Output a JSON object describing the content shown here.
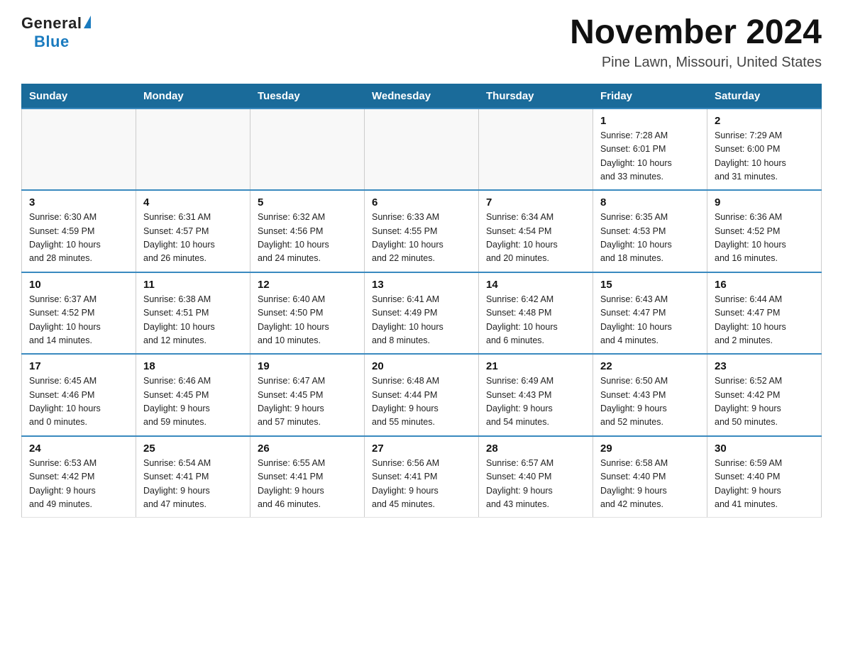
{
  "header": {
    "logo_general": "General",
    "logo_blue": "Blue",
    "month_title": "November 2024",
    "location": "Pine Lawn, Missouri, United States"
  },
  "weekdays": [
    "Sunday",
    "Monday",
    "Tuesday",
    "Wednesday",
    "Thursday",
    "Friday",
    "Saturday"
  ],
  "weeks": [
    [
      {
        "day": "",
        "info": ""
      },
      {
        "day": "",
        "info": ""
      },
      {
        "day": "",
        "info": ""
      },
      {
        "day": "",
        "info": ""
      },
      {
        "day": "",
        "info": ""
      },
      {
        "day": "1",
        "info": "Sunrise: 7:28 AM\nSunset: 6:01 PM\nDaylight: 10 hours\nand 33 minutes."
      },
      {
        "day": "2",
        "info": "Sunrise: 7:29 AM\nSunset: 6:00 PM\nDaylight: 10 hours\nand 31 minutes."
      }
    ],
    [
      {
        "day": "3",
        "info": "Sunrise: 6:30 AM\nSunset: 4:59 PM\nDaylight: 10 hours\nand 28 minutes."
      },
      {
        "day": "4",
        "info": "Sunrise: 6:31 AM\nSunset: 4:57 PM\nDaylight: 10 hours\nand 26 minutes."
      },
      {
        "day": "5",
        "info": "Sunrise: 6:32 AM\nSunset: 4:56 PM\nDaylight: 10 hours\nand 24 minutes."
      },
      {
        "day": "6",
        "info": "Sunrise: 6:33 AM\nSunset: 4:55 PM\nDaylight: 10 hours\nand 22 minutes."
      },
      {
        "day": "7",
        "info": "Sunrise: 6:34 AM\nSunset: 4:54 PM\nDaylight: 10 hours\nand 20 minutes."
      },
      {
        "day": "8",
        "info": "Sunrise: 6:35 AM\nSunset: 4:53 PM\nDaylight: 10 hours\nand 18 minutes."
      },
      {
        "day": "9",
        "info": "Sunrise: 6:36 AM\nSunset: 4:52 PM\nDaylight: 10 hours\nand 16 minutes."
      }
    ],
    [
      {
        "day": "10",
        "info": "Sunrise: 6:37 AM\nSunset: 4:52 PM\nDaylight: 10 hours\nand 14 minutes."
      },
      {
        "day": "11",
        "info": "Sunrise: 6:38 AM\nSunset: 4:51 PM\nDaylight: 10 hours\nand 12 minutes."
      },
      {
        "day": "12",
        "info": "Sunrise: 6:40 AM\nSunset: 4:50 PM\nDaylight: 10 hours\nand 10 minutes."
      },
      {
        "day": "13",
        "info": "Sunrise: 6:41 AM\nSunset: 4:49 PM\nDaylight: 10 hours\nand 8 minutes."
      },
      {
        "day": "14",
        "info": "Sunrise: 6:42 AM\nSunset: 4:48 PM\nDaylight: 10 hours\nand 6 minutes."
      },
      {
        "day": "15",
        "info": "Sunrise: 6:43 AM\nSunset: 4:47 PM\nDaylight: 10 hours\nand 4 minutes."
      },
      {
        "day": "16",
        "info": "Sunrise: 6:44 AM\nSunset: 4:47 PM\nDaylight: 10 hours\nand 2 minutes."
      }
    ],
    [
      {
        "day": "17",
        "info": "Sunrise: 6:45 AM\nSunset: 4:46 PM\nDaylight: 10 hours\nand 0 minutes."
      },
      {
        "day": "18",
        "info": "Sunrise: 6:46 AM\nSunset: 4:45 PM\nDaylight: 9 hours\nand 59 minutes."
      },
      {
        "day": "19",
        "info": "Sunrise: 6:47 AM\nSunset: 4:45 PM\nDaylight: 9 hours\nand 57 minutes."
      },
      {
        "day": "20",
        "info": "Sunrise: 6:48 AM\nSunset: 4:44 PM\nDaylight: 9 hours\nand 55 minutes."
      },
      {
        "day": "21",
        "info": "Sunrise: 6:49 AM\nSunset: 4:43 PM\nDaylight: 9 hours\nand 54 minutes."
      },
      {
        "day": "22",
        "info": "Sunrise: 6:50 AM\nSunset: 4:43 PM\nDaylight: 9 hours\nand 52 minutes."
      },
      {
        "day": "23",
        "info": "Sunrise: 6:52 AM\nSunset: 4:42 PM\nDaylight: 9 hours\nand 50 minutes."
      }
    ],
    [
      {
        "day": "24",
        "info": "Sunrise: 6:53 AM\nSunset: 4:42 PM\nDaylight: 9 hours\nand 49 minutes."
      },
      {
        "day": "25",
        "info": "Sunrise: 6:54 AM\nSunset: 4:41 PM\nDaylight: 9 hours\nand 47 minutes."
      },
      {
        "day": "26",
        "info": "Sunrise: 6:55 AM\nSunset: 4:41 PM\nDaylight: 9 hours\nand 46 minutes."
      },
      {
        "day": "27",
        "info": "Sunrise: 6:56 AM\nSunset: 4:41 PM\nDaylight: 9 hours\nand 45 minutes."
      },
      {
        "day": "28",
        "info": "Sunrise: 6:57 AM\nSunset: 4:40 PM\nDaylight: 9 hours\nand 43 minutes."
      },
      {
        "day": "29",
        "info": "Sunrise: 6:58 AM\nSunset: 4:40 PM\nDaylight: 9 hours\nand 42 minutes."
      },
      {
        "day": "30",
        "info": "Sunrise: 6:59 AM\nSunset: 4:40 PM\nDaylight: 9 hours\nand 41 minutes."
      }
    ]
  ]
}
